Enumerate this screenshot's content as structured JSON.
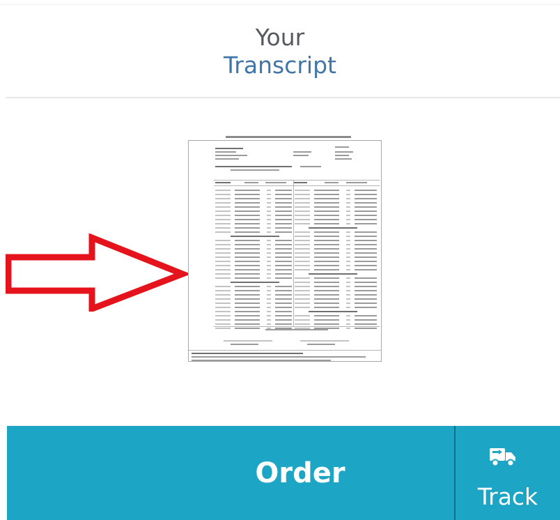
{
  "header": {
    "line1": "Your",
    "line2": "Transcript"
  },
  "preview": {
    "image_name": "transcript-document-thumbnail",
    "pointer_icon": "red-arrow-right"
  },
  "actions": {
    "order_label": "Order",
    "track_label": "Track",
    "track_icon": "delivery-truck-icon"
  },
  "colors": {
    "bar_background": "#1ca5c4",
    "header_muted": "#555a60",
    "header_accent": "#3f75a8",
    "arrow": "#e5131c"
  }
}
